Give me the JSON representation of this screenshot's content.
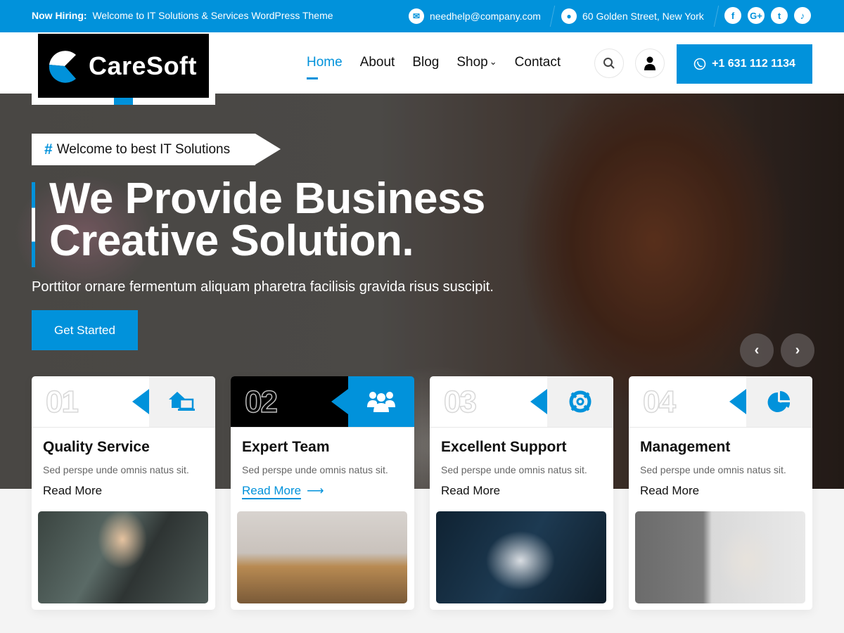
{
  "topbar": {
    "hiring_label": "Now Hiring:",
    "hiring_text": "Welcome to IT Solutions & Services WordPress Theme",
    "email": "needhelp@company.com",
    "address": "60 Golden Street, New York",
    "socials": [
      "facebook",
      "google-plus",
      "twitter",
      "tiktok"
    ],
    "social_glyphs": [
      "f",
      "G+",
      "t",
      "♪"
    ]
  },
  "logo": {
    "text": "CareSoft"
  },
  "nav": {
    "items": [
      {
        "label": "Home",
        "active": true
      },
      {
        "label": "About"
      },
      {
        "label": "Blog"
      },
      {
        "label": "Shop",
        "has_dropdown": true
      },
      {
        "label": "Contact"
      }
    ],
    "phone": "+1 631 112 1134"
  },
  "hero": {
    "tagline_hash": "#",
    "tagline": "Welcome to best IT Solutions",
    "title_line1": "We Provide Business",
    "title_line2": "Creative Solution.",
    "subtitle": "Porttitor ornare fermentum aliquam pharetra facilisis gravida risus suscipit.",
    "cta": "Get Started",
    "prev": "‹",
    "next": "›"
  },
  "cards": [
    {
      "num": "01",
      "title": "Quality Service",
      "desc": "Sed perspe unde omnis natus sit.",
      "link": "Read More",
      "icon": "home-laptop-icon"
    },
    {
      "num": "02",
      "title": "Expert Team",
      "desc": "Sed perspe unde omnis natus sit.",
      "link": "Read More",
      "arrow": "⟶",
      "icon": "team-icon",
      "active": true
    },
    {
      "num": "03",
      "title": "Excellent Support",
      "desc": "Sed perspe unde omnis natus sit.",
      "link": "Read More",
      "icon": "lifebuoy-icon"
    },
    {
      "num": "04",
      "title": "Management",
      "desc": "Sed perspe unde omnis natus sit.",
      "link": "Read More",
      "icon": "pie-chart-icon"
    }
  ],
  "colors": {
    "accent": "#0192db",
    "dark": "#000000",
    "text": "#111111"
  }
}
